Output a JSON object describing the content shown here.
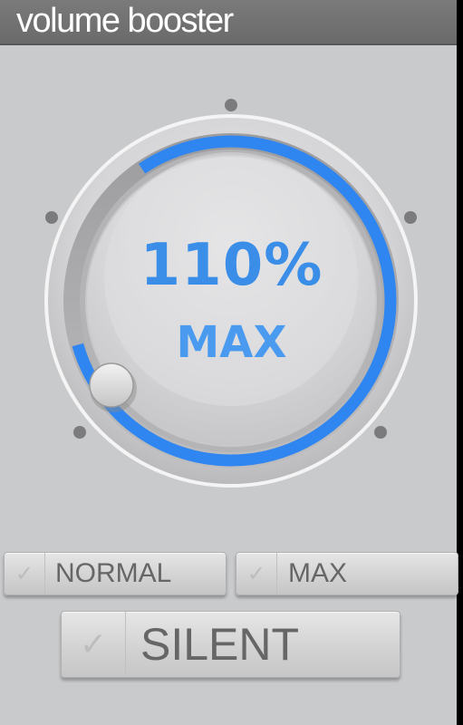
{
  "app": {
    "title": "volume booster"
  },
  "dial": {
    "percent_text": "110%",
    "mode_text": "MAX",
    "level_fraction": 1.0,
    "accent_color": "#2f86f0"
  },
  "buttons": {
    "normal": {
      "label": "NORMAL",
      "check_icon": "check-icon"
    },
    "max": {
      "label": "MAX",
      "check_icon": "check-icon"
    },
    "silent": {
      "label": "SILENT",
      "check_icon": "check-icon"
    }
  }
}
